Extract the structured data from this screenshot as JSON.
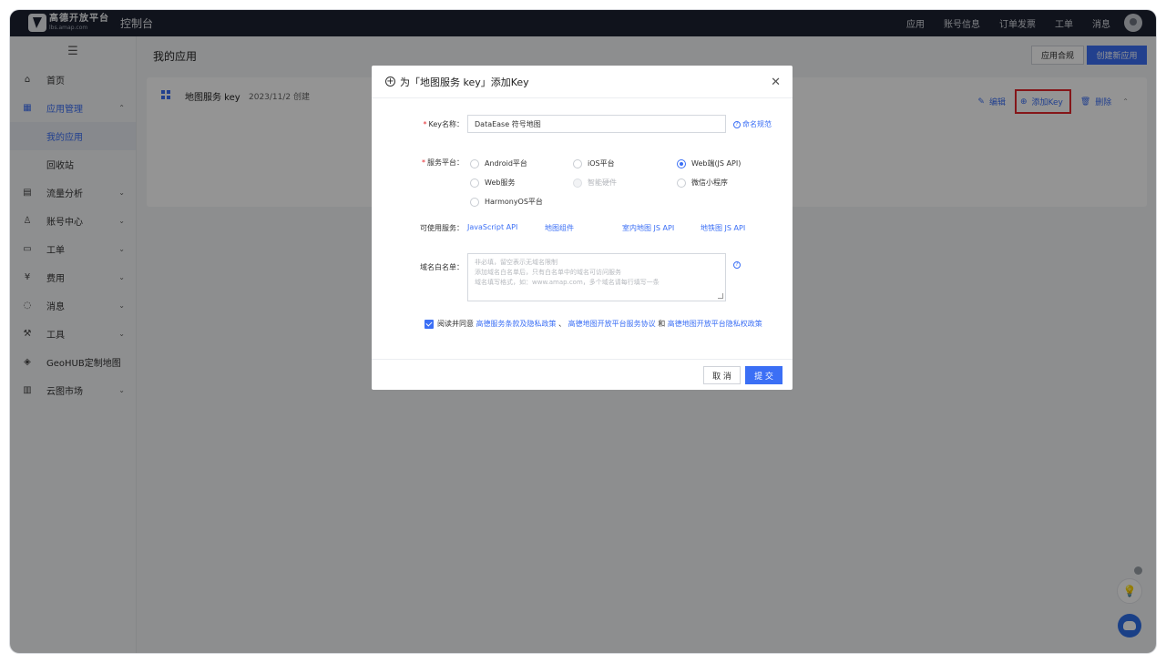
{
  "topbar": {
    "logo_name": "高德开放平台",
    "logo_sub": "lbs.amap.com",
    "console": "控制台",
    "nav": [
      "应用",
      "账号信息",
      "订单发票",
      "工单",
      "消息"
    ]
  },
  "sidebar": {
    "items": [
      {
        "label": "首页",
        "icon": "home-icon"
      },
      {
        "label": "应用管理",
        "icon": "apps-icon"
      },
      {
        "label": "我的应用"
      },
      {
        "label": "回收站"
      },
      {
        "label": "流量分析",
        "icon": "chart-icon"
      },
      {
        "label": "账号中心",
        "icon": "user-icon"
      },
      {
        "label": "工单",
        "icon": "ticket-icon"
      },
      {
        "label": "费用",
        "icon": "fee-icon"
      },
      {
        "label": "消息",
        "icon": "message-icon"
      },
      {
        "label": "工具",
        "icon": "tool-icon"
      },
      {
        "label": "GeoHUB定制地图",
        "icon": "layers-icon"
      },
      {
        "label": "云图市场",
        "icon": "store-icon"
      }
    ]
  },
  "main": {
    "title": "我的应用",
    "compliance_button": "应用合规",
    "create_button": "创建新应用",
    "app": {
      "name": "地图服务 key",
      "created": "2023/11/2 创建",
      "edit": "编辑",
      "add_key": "添加Key",
      "delete": "删除"
    }
  },
  "modal": {
    "title": "为「地图服务 key」添加Key",
    "key_name_label": "Key名称：",
    "key_name_value": "DataEase 符号地图",
    "naming_rules": "命名规范",
    "platform_label": "服务平台：",
    "platforms": [
      {
        "label": "Android平台",
        "checked": false,
        "disabled": false
      },
      {
        "label": "iOS平台",
        "checked": false,
        "disabled": false
      },
      {
        "label": "Web端(JS API)",
        "checked": true,
        "disabled": false
      },
      {
        "label": "Web服务",
        "checked": false,
        "disabled": false
      },
      {
        "label": "智能硬件",
        "checked": false,
        "disabled": true
      },
      {
        "label": "微信小程序",
        "checked": false,
        "disabled": false
      },
      {
        "label": "HarmonyOS平台",
        "checked": false,
        "disabled": false
      }
    ],
    "services_label": "可使用服务：",
    "services": [
      "JavaScript API",
      "地图组件",
      "室内地图 JS API",
      "地铁图 JS API"
    ],
    "domain_label": "域名白名单：",
    "domain_placeholder": [
      "非必填，留空表示无域名限制",
      "添加域名白名单后，只有白名单中的域名可访问服务",
      "域名填写格式，如：www.amap.com，多个域名请每行填写一条"
    ],
    "agree_prefix": "阅读并同意",
    "agree_link1": "高德服务条款及隐私政策",
    "agree_sep1": "、",
    "agree_link2": "高德地图开放平台服务协议",
    "agree_sep2": "和",
    "agree_link3": "高德地图开放平台隐私权政策",
    "cancel": "取 消",
    "submit": "提 交"
  },
  "colors": {
    "accent": "#3b6ff5",
    "topbar": "#1d2231",
    "highlight": "#e5262b"
  }
}
